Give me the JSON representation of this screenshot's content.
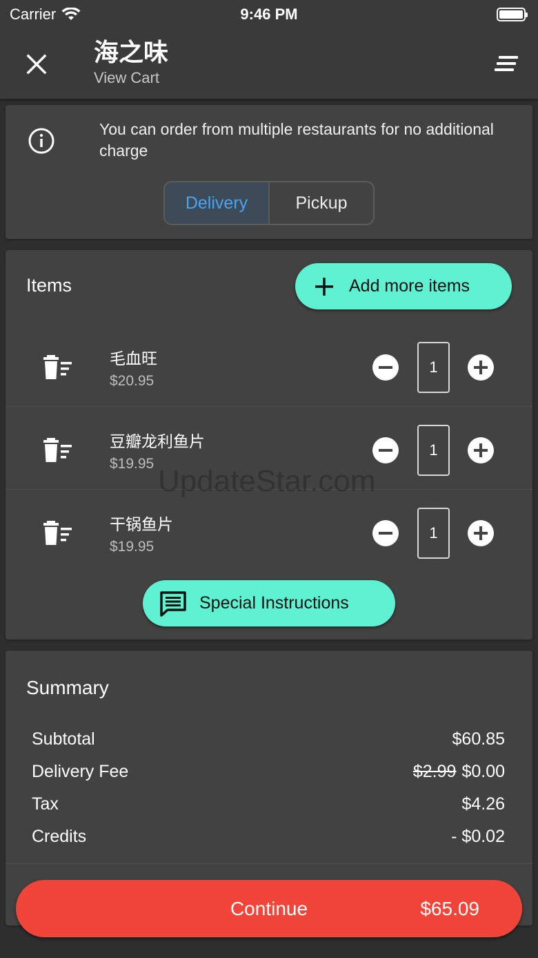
{
  "status_bar": {
    "carrier": "Carrier",
    "time": "9:46 PM"
  },
  "header": {
    "title": "海之味",
    "subtitle": "View Cart",
    "close_icon": "close-icon",
    "menu_icon": "sort-icon"
  },
  "info": {
    "message": "You can order from multiple restaurants for no additional charge",
    "options": [
      "Delivery",
      "Pickup"
    ],
    "selected": "Delivery"
  },
  "items_section": {
    "label": "Items",
    "add_button": "Add more items",
    "items": [
      {
        "name": "毛血旺",
        "price": "$20.95",
        "qty": "1"
      },
      {
        "name": "豆瓣龙利鱼片",
        "price": "$19.95",
        "qty": "1"
      },
      {
        "name": "干锅鱼片",
        "price": "$19.95",
        "qty": "1"
      }
    ],
    "special_button": "Special Instructions"
  },
  "summary": {
    "label": "Summary",
    "subtotal_label": "Subtotal",
    "subtotal_value": "$60.85",
    "delivery_label": "Delivery Fee",
    "delivery_original": "$2.99",
    "delivery_value": "$0.00",
    "tax_label": "Tax",
    "tax_value": "$4.26",
    "credits_label": "Credits",
    "credits_value": "- $0.02"
  },
  "footer": {
    "continue_label": "Continue",
    "total": "$65.09"
  },
  "watermark": "UpdateStar.com",
  "colors": {
    "accent": "#5ef2d2",
    "primary_action": "#f14539",
    "selected_tab": "#4aa3f0",
    "card": "#424242",
    "background": "#2e2e2e"
  }
}
